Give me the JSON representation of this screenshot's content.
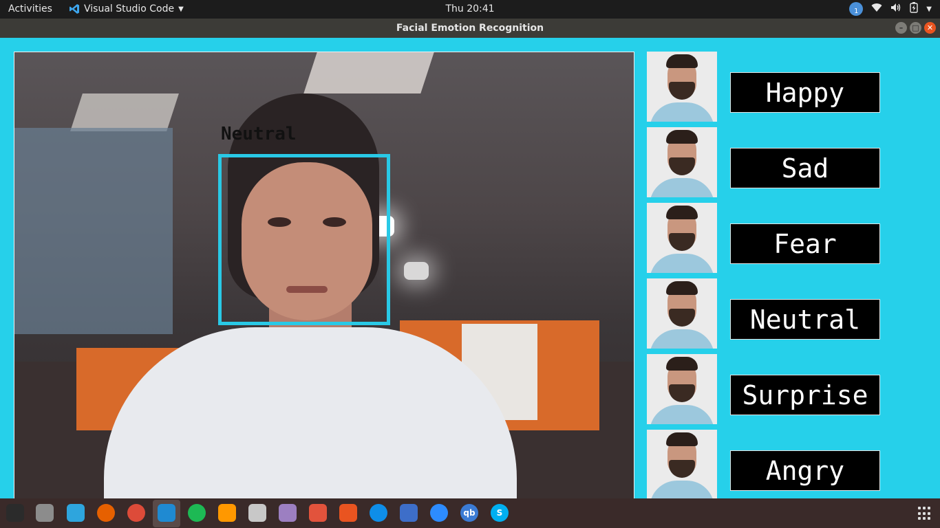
{
  "topbar": {
    "activities": "Activities",
    "app_name": "Visual Studio Code",
    "clock": "Thu 20:41",
    "notification_count": "1"
  },
  "window": {
    "title": "Facial Emotion Recognition"
  },
  "camera": {
    "detected_label": "Neutral"
  },
  "emotions": [
    {
      "label": "Happy"
    },
    {
      "label": "Sad"
    },
    {
      "label": "Fear"
    },
    {
      "label": "Neutral"
    },
    {
      "label": "Surprise"
    },
    {
      "label": "Angry"
    }
  ],
  "dock": {
    "apps": [
      {
        "name": "terminal-icon",
        "color": "#2b2b2b"
      },
      {
        "name": "file-manager-icon",
        "color": "#8c8c8c"
      },
      {
        "name": "telegram-icon",
        "color": "#2ea5dd"
      },
      {
        "name": "firefox-icon",
        "color": "#e66000"
      },
      {
        "name": "chrome-icon",
        "color": "#dd4b39"
      },
      {
        "name": "vscode-icon",
        "color": "#1f8ad2"
      },
      {
        "name": "spotify-icon",
        "color": "#1db954"
      },
      {
        "name": "sublime-icon",
        "color": "#ff9800"
      },
      {
        "name": "disk-icon",
        "color": "#c8c8c8"
      },
      {
        "name": "screenshot-icon",
        "color": "#9c7fc1"
      },
      {
        "name": "calculator-icon",
        "color": "#e2533c"
      },
      {
        "name": "software-center-icon",
        "color": "#e95420"
      },
      {
        "name": "teamviewer-icon",
        "color": "#0e8ee9"
      },
      {
        "name": "tasks-icon",
        "color": "#3d6ec9"
      },
      {
        "name": "zoom-icon",
        "color": "#2d8cff"
      },
      {
        "name": "qbittorrent-icon",
        "color": "#3b7bd4"
      },
      {
        "name": "skype-icon",
        "color": "#00aff0"
      }
    ],
    "qb_label": "qb",
    "skype_label": "S"
  },
  "colors": {
    "background": "#26d0ea",
    "face_box": "#29c9e6"
  }
}
